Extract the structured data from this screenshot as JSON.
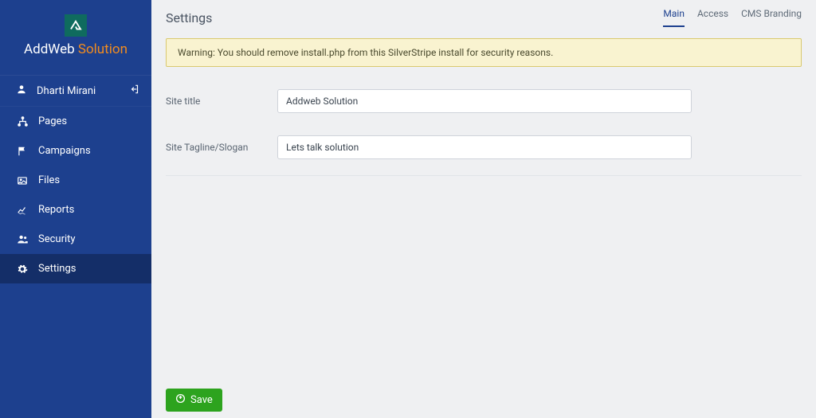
{
  "brand": {
    "name_a": "AddWeb",
    "name_b": " Solution"
  },
  "user": {
    "name": "Dharti Mirani"
  },
  "sidebar": {
    "items": [
      {
        "label": "Pages"
      },
      {
        "label": "Campaigns"
      },
      {
        "label": "Files"
      },
      {
        "label": "Reports"
      },
      {
        "label": "Security"
      },
      {
        "label": "Settings"
      }
    ]
  },
  "page": {
    "title": "Settings"
  },
  "tabs": {
    "main": "Main",
    "access": "Access",
    "cms": "CMS Branding"
  },
  "alert": {
    "text": "Warning: You should remove install.php from this SilverStripe install for security reasons."
  },
  "form": {
    "site_title_label": "Site title",
    "site_title_value": "Addweb Solution",
    "tagline_label": "Site Tagline/Slogan",
    "tagline_value": "Lets talk solution"
  },
  "buttons": {
    "save": "Save"
  }
}
